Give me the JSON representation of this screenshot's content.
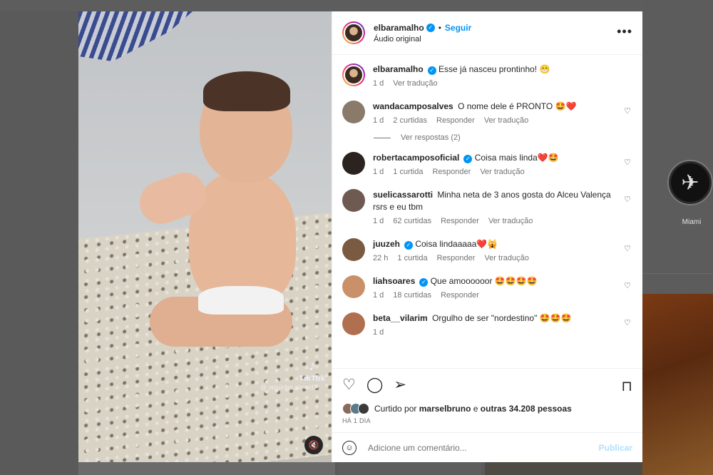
{
  "background": {
    "story_label": "Miami"
  },
  "video": {
    "watermark_brand": "TikTok",
    "watermark_user": "@ jaguinho.almeid7",
    "mute_icon": "mute-icon"
  },
  "header": {
    "username": "elbaramalho",
    "separator": "•",
    "follow_label": "Seguir",
    "audio": "Áudio original",
    "more": "•••"
  },
  "caption": {
    "username": "elbaramalho",
    "text": "Esse já nasceu prontinho! 😁",
    "time": "1 d",
    "translate": "Ver tradução"
  },
  "comments": [
    {
      "username": "wandacamposalves",
      "verified": false,
      "text": "O nome dele é PRONTO 🤩❤️",
      "time": "1 d",
      "likes": "2 curtidas",
      "reply": "Responder",
      "translate": "Ver tradução",
      "avatar_color": "#8a7a6a"
    },
    {
      "username": "robertacamposoficial",
      "verified": true,
      "text": "Coisa mais linda❤️🤩",
      "time": "1 d",
      "likes": "1 curtida",
      "reply": "Responder",
      "translate": "Ver tradução",
      "avatar_color": "#2a2320"
    },
    {
      "username": "suelicassarotti",
      "verified": false,
      "text": "Minha neta de 3 anos gosta do Alceu Valença rsrs e eu tbm",
      "time": "1 d",
      "likes": "62 curtidas",
      "reply": "Responder",
      "translate": "Ver tradução",
      "avatar_color": "#6e5a50"
    },
    {
      "username": "juuzeh",
      "verified": true,
      "text": "Coisa lindaaaaa❤️🙀",
      "time": "22 h",
      "likes": "1 curtida",
      "reply": "Responder",
      "translate": "Ver tradução",
      "avatar_color": "#7a5a40"
    },
    {
      "username": "liahsoares",
      "verified": true,
      "text": "Que amoooooor 🤩🤩🤩🤩",
      "time": "1 d",
      "likes": "18 curtidas",
      "reply": "Responder",
      "translate": "",
      "avatar_color": "#c9906a"
    },
    {
      "username": "beta__vilarim",
      "verified": false,
      "text": "Orgulho de ser \"nordestino\" 🤩🤩🤩",
      "time": "1 d",
      "likes": "",
      "reply": "",
      "translate": "",
      "avatar_color": "#b07050"
    }
  ],
  "view_replies": "Ver respostas (2)",
  "likes": {
    "prefix": "Curtido por",
    "user": "marselbruno",
    "middle": "e",
    "others": "outras 34.208 pessoas"
  },
  "post_age": "HÁ 1 DIA",
  "comment_input": {
    "placeholder": "Adicione um comentário...",
    "publish": "Publicar"
  },
  "colors": {
    "accent": "#0095f6",
    "publish_disabled": "#b2dffc",
    "text": "#262626",
    "muted": "#737373"
  }
}
